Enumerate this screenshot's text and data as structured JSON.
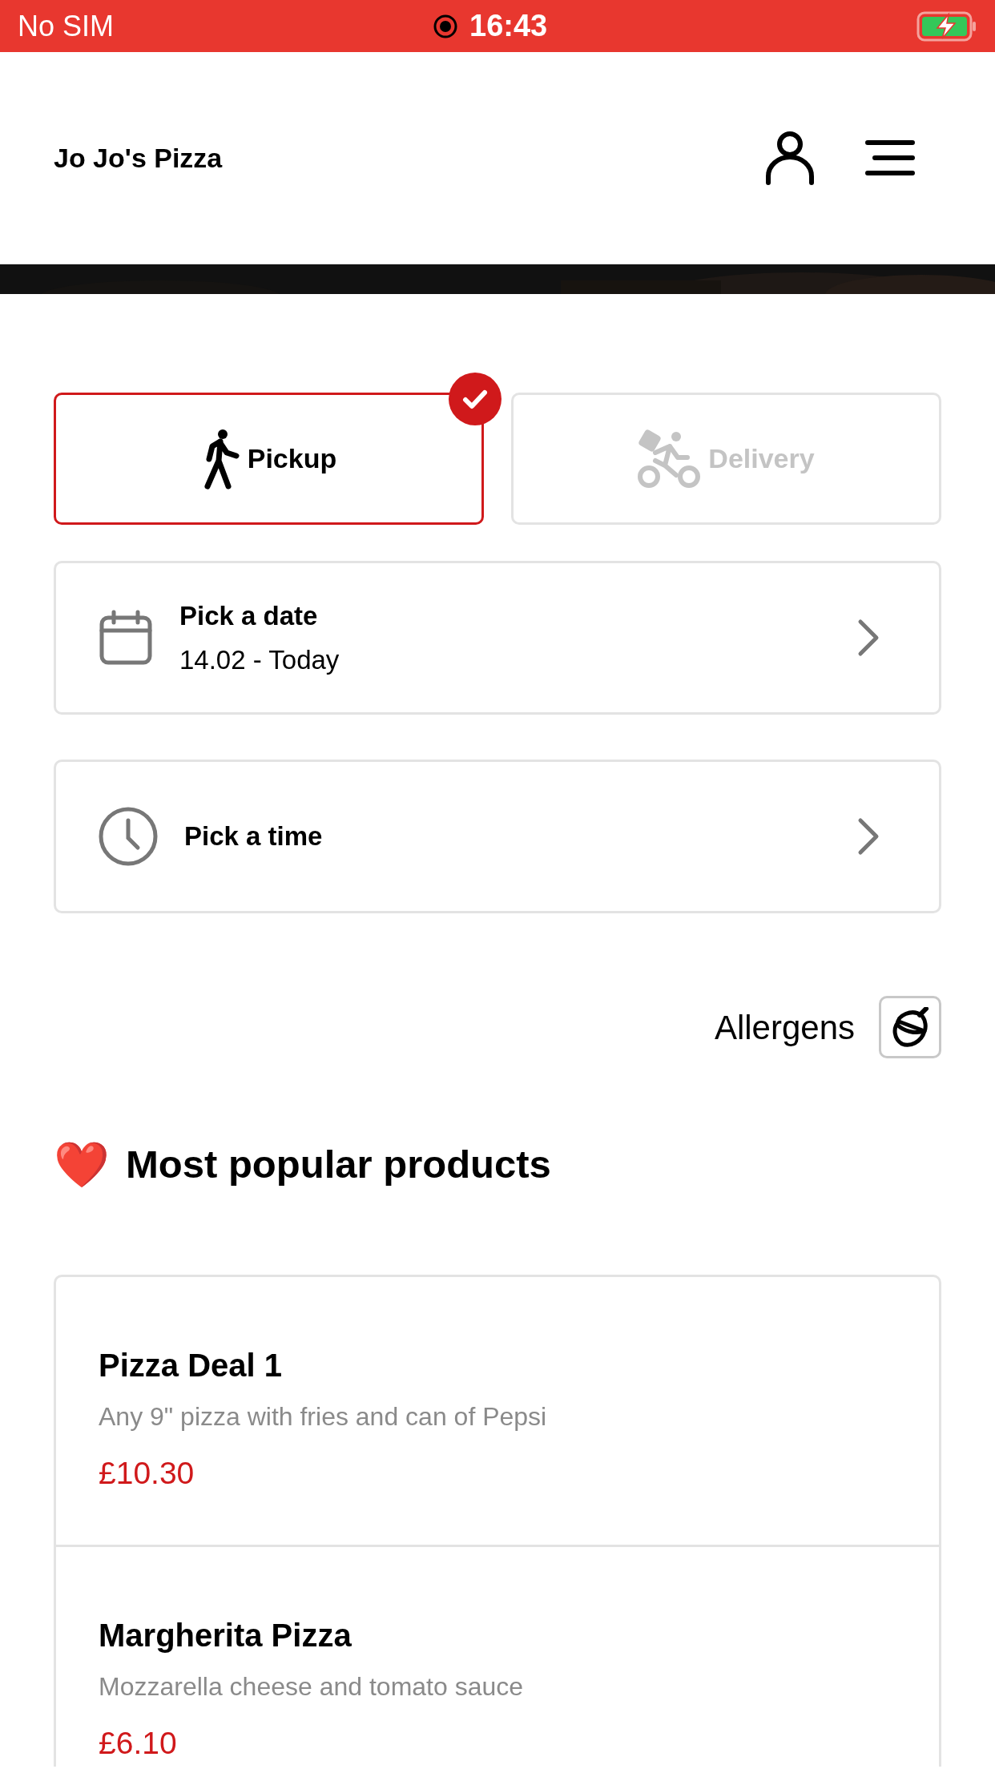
{
  "status_bar": {
    "carrier": "No SIM",
    "time": "16:43"
  },
  "header": {
    "title": "Jo Jo's Pizza"
  },
  "modes": [
    {
      "kind": "pickup",
      "label": "Pickup",
      "selected": true
    },
    {
      "kind": "delivery",
      "label": "Delivery",
      "selected": false
    }
  ],
  "pickers": [
    {
      "kind": "date",
      "label": "Pick a date",
      "value": "14.02 - Today"
    },
    {
      "kind": "time",
      "label": "Pick a time"
    }
  ],
  "allergens": {
    "label": "Allergens"
  },
  "section": {
    "emoji": "❤️",
    "title": "Most popular products"
  },
  "products": [
    {
      "name": "Pizza Deal 1",
      "description": "Any 9\" pizza with fries and can of Pepsi",
      "price": "£10.30"
    },
    {
      "name": "Margherita Pizza",
      "description": "Mozzarella cheese and tomato sauce",
      "price": "£6.10"
    }
  ]
}
